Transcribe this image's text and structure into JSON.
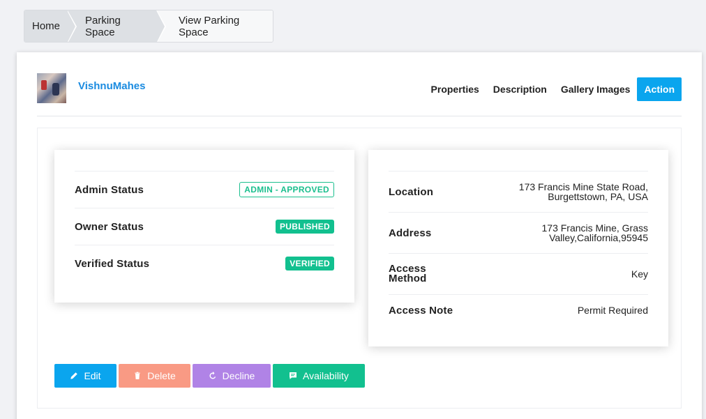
{
  "breadcrumb": {
    "items": [
      "Home",
      "Parking Space",
      "View Parking Space"
    ]
  },
  "header": {
    "username": "VishnuMahes",
    "tabs": [
      "Properties",
      "Description",
      "Gallery Images",
      "Action"
    ],
    "active_tab": "Action"
  },
  "status": {
    "rows": [
      {
        "label": "Admin Status",
        "badge": "ADMIN - APPROVED",
        "style": "outline"
      },
      {
        "label": "Owner Status",
        "badge": "PUBLISHED",
        "style": "solid"
      },
      {
        "label": "Verified Status",
        "badge": "VERIFIED",
        "style": "solid"
      }
    ]
  },
  "details": {
    "location_label": "Location",
    "location_line1": "173 Francis Mine State Road,",
    "location_line2": "Burgettstown, PA, USA",
    "address_label": "Address",
    "address_line1": "173 Francis Mine, Grass",
    "address_line2": "Valley,California,95945",
    "access_method_label_1": "Access",
    "access_method_label_2": "Method",
    "access_method_value": "Key",
    "access_note_label": "Access Note",
    "access_note_value": "Permit Required"
  },
  "actions": {
    "edit": "Edit",
    "delete": "Delete",
    "decline": "Decline",
    "availability": "Availability"
  },
  "colors": {
    "accent": "#0aa5ee",
    "success": "#12c08f",
    "danger": "#f99a84",
    "purple": "#b083e6",
    "link": "#1a8be0"
  },
  "icons": {
    "edit": "pencil-icon",
    "delete": "trash-icon",
    "decline": "refresh-icon",
    "availability": "chat-icon"
  }
}
